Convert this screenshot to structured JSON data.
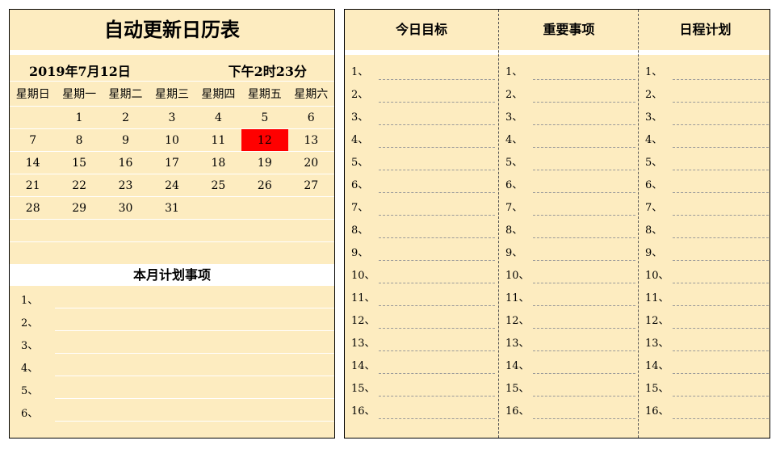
{
  "calendar_panel": {
    "title": "自动更新日历表",
    "date": "2019年7月12日",
    "time": "下午2时23分",
    "weekdays": [
      "星期日",
      "星期一",
      "星期二",
      "星期三",
      "星期四",
      "星期五",
      "星期六"
    ],
    "weeks": [
      [
        "",
        "1",
        "2",
        "3",
        "4",
        "5",
        "6"
      ],
      [
        "7",
        "8",
        "9",
        "10",
        "11",
        "12",
        "13"
      ],
      [
        "14",
        "15",
        "16",
        "17",
        "18",
        "19",
        "20"
      ],
      [
        "21",
        "22",
        "23",
        "24",
        "25",
        "26",
        "27"
      ],
      [
        "28",
        "29",
        "30",
        "31",
        "",
        "",
        ""
      ],
      [
        "",
        "",
        "",
        "",
        "",
        "",
        ""
      ],
      [
        "",
        "",
        "",
        "",
        "",
        "",
        ""
      ]
    ],
    "today": "12",
    "today_color": "#ff0000",
    "month_plan_title": "本月计划事项",
    "month_plan_items": [
      "1、",
      "2、",
      "3、",
      "4、",
      "5、",
      "6、"
    ]
  },
  "planner": {
    "columns": [
      {
        "title": "今日目标"
      },
      {
        "title": "重要事项"
      },
      {
        "title": "日程计划"
      }
    ],
    "items": [
      "1、",
      "2、",
      "3、",
      "4、",
      "5、",
      "6、",
      "7、",
      "8、",
      "9、",
      "10、",
      "11、",
      "12、",
      "13、",
      "14、",
      "15、",
      "16、"
    ]
  },
  "colors": {
    "panel_bg": "#fdecc0",
    "highlight": "#ff0000"
  }
}
